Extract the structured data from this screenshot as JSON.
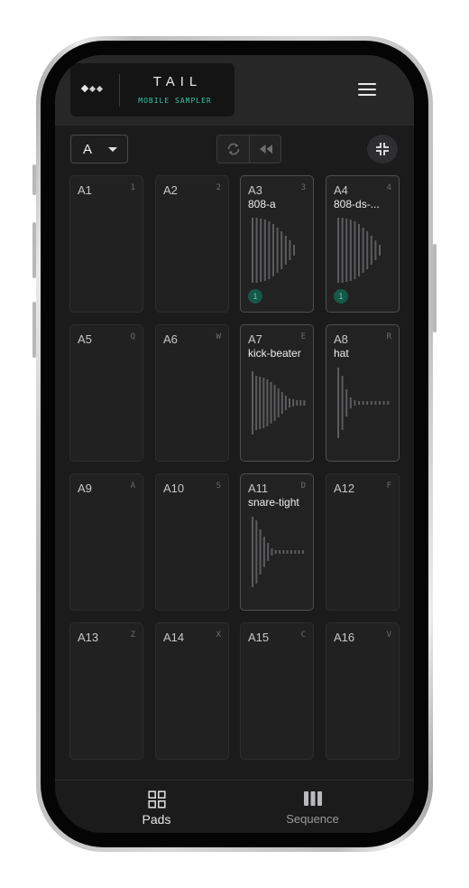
{
  "app": {
    "title": "TAIL",
    "subtitle": "MOBILE SAMPLER",
    "logo_icon": "diamond-dots-icon",
    "menu_icon": "hamburger-menu-icon"
  },
  "toolbar": {
    "bank_selected": "A",
    "bank_icon": "chevron-down-icon",
    "loop_icon": "loop-icon",
    "rewind_icon": "rewind-icon",
    "collapse_icon": "collapse-icon"
  },
  "colors": {
    "accent": "#35c8a6",
    "badge_bg": "#165748",
    "screen_bg": "#1b1b1c",
    "header_bg": "#272728"
  },
  "pads": [
    {
      "label": "A1",
      "key": "1",
      "sample": "",
      "badge": ""
    },
    {
      "label": "A2",
      "key": "2",
      "sample": "",
      "badge": ""
    },
    {
      "label": "A3",
      "key": "3",
      "sample": "808-a",
      "badge": "1"
    },
    {
      "label": "A4",
      "key": "4",
      "sample": "808-ds-...",
      "badge": "1"
    },
    {
      "label": "A5",
      "key": "Q",
      "sample": "",
      "badge": ""
    },
    {
      "label": "A6",
      "key": "W",
      "sample": "",
      "badge": ""
    },
    {
      "label": "A7",
      "key": "E",
      "sample": "kick-beater",
      "badge": ""
    },
    {
      "label": "A8",
      "key": "R",
      "sample": "hat",
      "badge": ""
    },
    {
      "label": "A9",
      "key": "A",
      "sample": "",
      "badge": ""
    },
    {
      "label": "A10",
      "key": "S",
      "sample": "",
      "badge": ""
    },
    {
      "label": "A11",
      "key": "D",
      "sample": "snare-tight",
      "badge": ""
    },
    {
      "label": "A12",
      "key": "F",
      "sample": "",
      "badge": ""
    },
    {
      "label": "A13",
      "key": "Z",
      "sample": "",
      "badge": ""
    },
    {
      "label": "A14",
      "key": "X",
      "sample": "",
      "badge": ""
    },
    {
      "label": "A15",
      "key": "C",
      "sample": "",
      "badge": ""
    },
    {
      "label": "A16",
      "key": "V",
      "sample": "",
      "badge": ""
    }
  ],
  "tabs": [
    {
      "label": "Pads",
      "icon": "grid-icon",
      "active": true
    },
    {
      "label": "Sequence",
      "icon": "columns-icon",
      "active": false
    }
  ]
}
